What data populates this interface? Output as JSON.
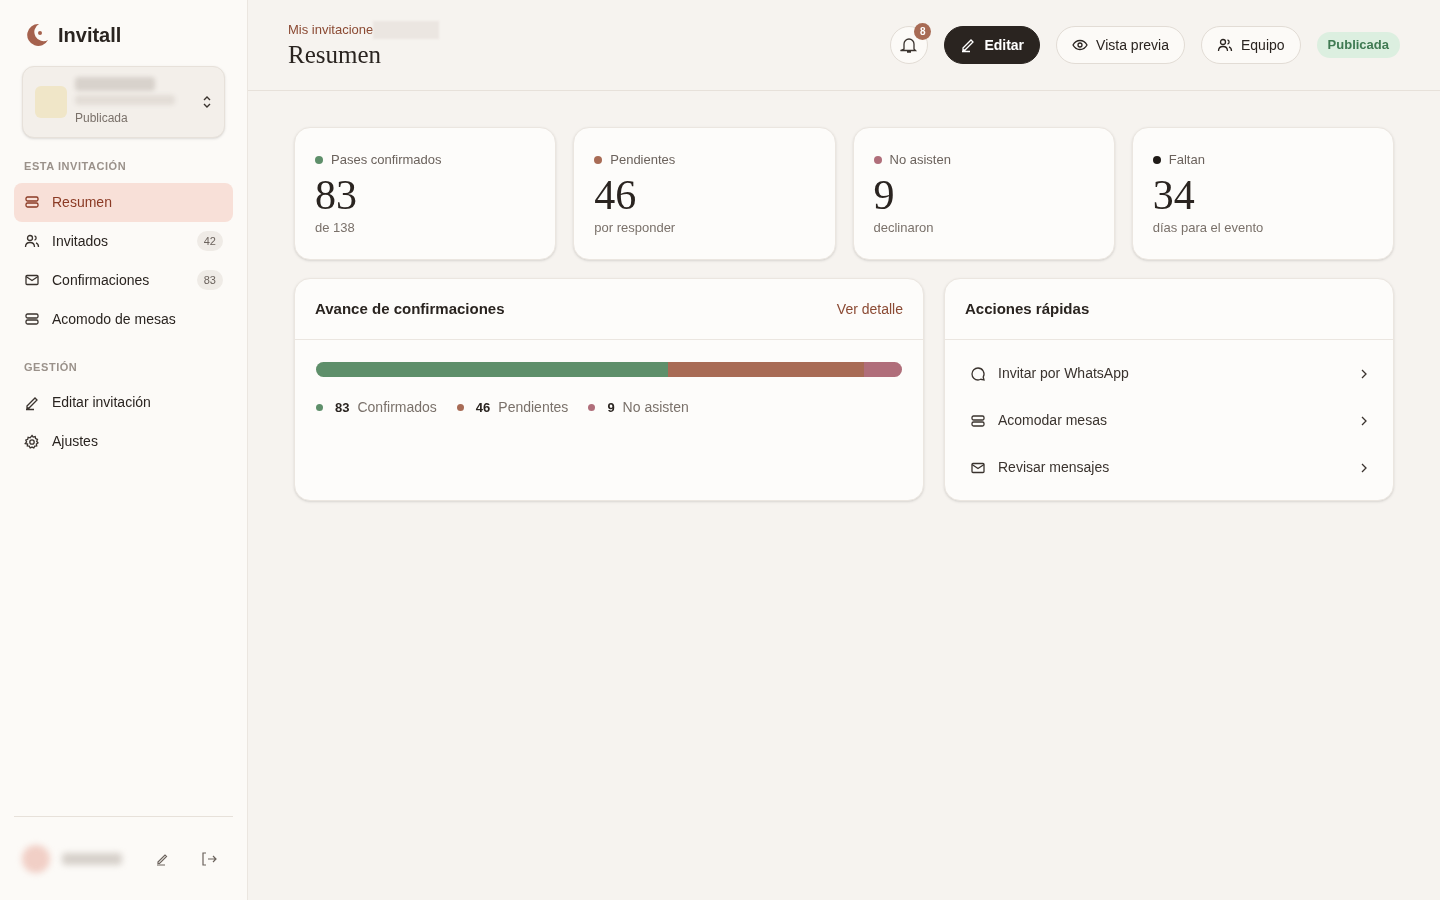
{
  "brand": {
    "name": "Invitall"
  },
  "invitation_switcher": {
    "status": "Publicada"
  },
  "sidebar": {
    "sections": [
      {
        "title": "ESTA INVITACIÓN",
        "items": [
          {
            "label": "Resumen",
            "selected": true
          },
          {
            "label": "Invitados",
            "count": "42",
            "selected": false
          },
          {
            "label": "Confirmaciones",
            "count": "83",
            "selected": false
          },
          {
            "label": "Acomodo de mesas",
            "selected": false
          }
        ]
      },
      {
        "title": "GESTIÓN",
        "items": [
          {
            "label": "Editar invitación",
            "selected": false
          },
          {
            "label": "Ajustes",
            "selected": false
          }
        ]
      }
    ]
  },
  "header": {
    "breadcrumb": "Mis invitacione",
    "title": "Resumen",
    "notifications": "8",
    "buttons": [
      {
        "label": "Editar",
        "kind": "primary"
      },
      {
        "label": "Vista previa",
        "kind": "outline"
      },
      {
        "label": "Equipo",
        "kind": "outline"
      }
    ],
    "status": "Publicada"
  },
  "stats": [
    {
      "label": "Pases confirmados",
      "value": "83",
      "caption": "de 138",
      "color": "#5e8f6a"
    },
    {
      "label": "Pendientes",
      "value": "46",
      "caption": "por responder",
      "color": "#a86b55"
    },
    {
      "label": "No asisten",
      "value": "9",
      "caption": "declinaron",
      "color": "#b06e7a"
    },
    {
      "label": "Faltan",
      "value": "34",
      "caption": "días para el evento",
      "color": "#1f1a17"
    }
  ],
  "progress": {
    "title": "Avance de confirmaciones",
    "link": "Ver detalle",
    "segments": [
      {
        "value": "83",
        "label": "Confirmados",
        "color": "#5e8f6a"
      },
      {
        "value": "46",
        "label": "Pendientes",
        "color": "#a86b55"
      },
      {
        "value": "9",
        "label": "No asisten",
        "color": "#b06e7a"
      }
    ]
  },
  "quick_actions": {
    "title": "Acciones rápidas",
    "items": [
      {
        "label": "Invitar por WhatsApp"
      },
      {
        "label": "Acomodar mesas"
      },
      {
        "label": "Revisar mensajes"
      }
    ]
  }
}
